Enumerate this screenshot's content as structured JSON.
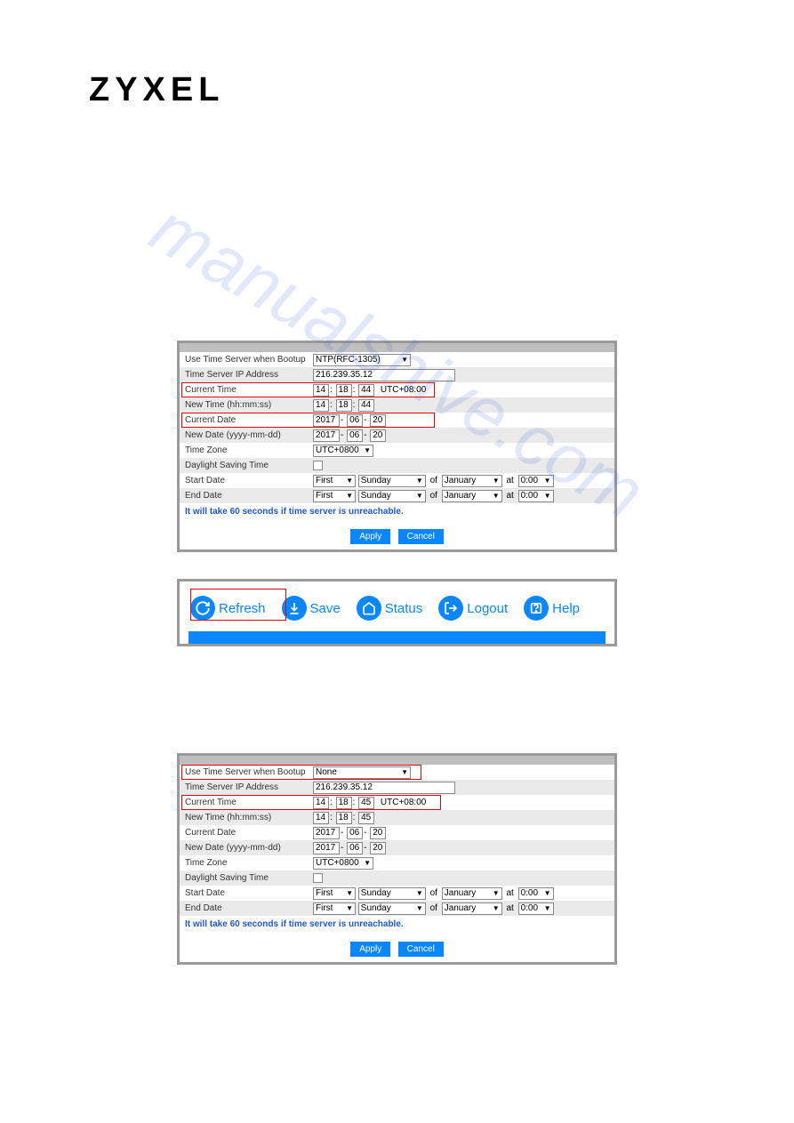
{
  "brand": "ZYXEL",
  "watermark": "manualshive.com",
  "panel1": {
    "rows": {
      "useTimeServer": {
        "label": "Use Time Server when Bootup",
        "value": "NTP(RFC-1305)"
      },
      "timeServerIp": {
        "label": "Time Server IP Address",
        "value": "216.239.35.12"
      },
      "currentTime": {
        "label": "Current Time",
        "h": "14",
        "m": "18",
        "s": "44",
        "tz": "UTC+08:00"
      },
      "newTime": {
        "label": "New Time (hh:mm:ss)",
        "h": "14",
        "m": "18",
        "s": "44"
      },
      "currentDate": {
        "label": "Current Date",
        "y": "2017",
        "mo": "06",
        "d": "20"
      },
      "newDate": {
        "label": "New Date (yyyy-mm-dd)",
        "y": "2017",
        "mo": "06",
        "d": "20"
      },
      "timeZone": {
        "label": "Time Zone",
        "value": "UTC+0800"
      },
      "dst": {
        "label": "Daylight Saving Time"
      },
      "startDate": {
        "label": "Start Date",
        "ord": "First",
        "dow": "Sunday",
        "of": "of",
        "month": "January",
        "at": "at",
        "time": "0:00"
      },
      "endDate": {
        "label": "End Date",
        "ord": "First",
        "dow": "Sunday",
        "of": "of",
        "month": "January",
        "at": "at",
        "time": "0:00"
      }
    },
    "note": "It will take 60 seconds if time server is unreachable.",
    "buttons": {
      "apply": "Apply",
      "cancel": "Cancel"
    }
  },
  "toolbar": {
    "refresh": "Refresh",
    "save": "Save",
    "status": "Status",
    "logout": "Logout",
    "help": "Help"
  },
  "panel2": {
    "rows": {
      "useTimeServer": {
        "label": "Use Time Server when Bootup",
        "value": "None"
      },
      "timeServerIp": {
        "label": "Time Server IP Address",
        "value": "216.239.35.12"
      },
      "currentTime": {
        "label": "Current Time",
        "h": "14",
        "m": "18",
        "s": "45",
        "tz": "UTC+08:00"
      },
      "newTime": {
        "label": "New Time (hh:mm:ss)",
        "h": "14",
        "m": "18",
        "s": "45"
      },
      "currentDate": {
        "label": "Current Date",
        "y": "2017",
        "mo": "06",
        "d": "20"
      },
      "newDate": {
        "label": "New Date (yyyy-mm-dd)",
        "y": "2017",
        "mo": "06",
        "d": "20"
      },
      "timeZone": {
        "label": "Time Zone",
        "value": "UTC+0800"
      },
      "dst": {
        "label": "Daylight Saving Time"
      },
      "startDate": {
        "label": "Start Date",
        "ord": "First",
        "dow": "Sunday",
        "of": "of",
        "month": "January",
        "at": "at",
        "time": "0:00"
      },
      "endDate": {
        "label": "End Date",
        "ord": "First",
        "dow": "Sunday",
        "of": "of",
        "month": "January",
        "at": "at",
        "time": "0:00"
      }
    },
    "note": "It will take 60 seconds if time server is unreachable.",
    "buttons": {
      "apply": "Apply",
      "cancel": "Cancel"
    }
  }
}
